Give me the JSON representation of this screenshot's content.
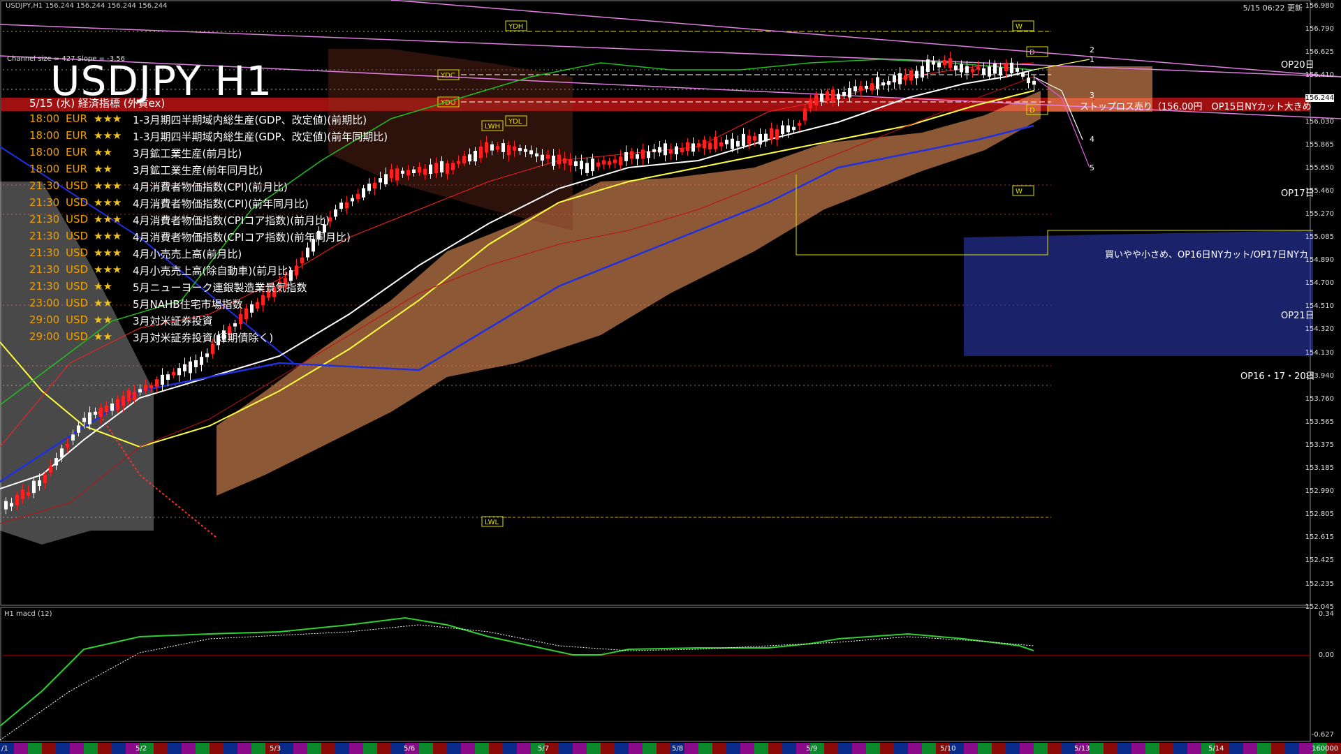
{
  "header": {
    "symbol_line": "USDJPY,H1  156.244 156.244 156.244 156.244",
    "title": "USDJPY H1",
    "channel_info": "Channel size = 427  Slope = -3.56",
    "timestamp": "5/15 06:22 更新"
  },
  "calendar": {
    "heading": "5/15 (水) 経済指標 (外貨ex)",
    "rows": [
      {
        "time": "18:00",
        "cur": "EUR",
        "stars": "★★★",
        "event": "1-3月期四半期域内総生産(GDP、改定値)(前期比)"
      },
      {
        "time": "18:00",
        "cur": "EUR",
        "stars": "★★★",
        "event": "1-3月期四半期域内総生産(GDP、改定値)(前年同期比)"
      },
      {
        "time": "18:00",
        "cur": "EUR",
        "stars": "★★",
        "event": "3月鉱工業生産(前月比)"
      },
      {
        "time": "18:00",
        "cur": "EUR",
        "stars": "★★",
        "event": "3月鉱工業生産(前年同月比)"
      },
      {
        "time": "21:30",
        "cur": "USD",
        "stars": "★★★",
        "event": "4月消費者物価指数(CPI)(前月比)"
      },
      {
        "time": "21:30",
        "cur": "USD",
        "stars": "★★★",
        "event": "4月消費者物価指数(CPI)(前年同月比)"
      },
      {
        "time": "21:30",
        "cur": "USD",
        "stars": "★★★",
        "event": "4月消費者物価指数(CPIコア指数)(前月比)"
      },
      {
        "time": "21:30",
        "cur": "USD",
        "stars": "★★★",
        "event": "4月消費者物価指数(CPIコア指数)(前年同月比)"
      },
      {
        "time": "21:30",
        "cur": "USD",
        "stars": "★★★",
        "event": "4月小売売上高(前月比)"
      },
      {
        "time": "21:30",
        "cur": "USD",
        "stars": "★★★",
        "event": "4月小売売上高(除自動車)(前月比)"
      },
      {
        "time": "21:30",
        "cur": "USD",
        "stars": "★★",
        "event": "5月ニューヨーク連銀製造業景気指数"
      },
      {
        "time": "23:00",
        "cur": "USD",
        "stars": "★★",
        "event": "5月NAHB住宅市場指数"
      },
      {
        "time": "29:00",
        "cur": "USD",
        "stars": "★★",
        "event": "3月対米証券投資"
      },
      {
        "time": "29:00",
        "cur": "USD",
        "stars": "★★",
        "event": "3月対米証券投資(短期債除く)"
      }
    ]
  },
  "level_tags": {
    "ydh": "YDH",
    "ydc": "YDC",
    "ydo": "YDO",
    "ydl": "YDL",
    "lwh": "LWH",
    "lwl": "LWL",
    "wh": "W",
    "wl": "W",
    "dh": "D",
    "dl": "D"
  },
  "wave_labels": [
    "2",
    "1",
    "3",
    "4",
    "5"
  ],
  "notes": {
    "stoploss": "ストップロス売り（156.00円　OP15日NYカット大きめ",
    "buy": "買いやや小さめ、OP16日NYカット/OP17日NYカ",
    "op20": "OP20日",
    "op17": "OP17日",
    "op21": "OP21日",
    "op16": "OP16・17・20日"
  },
  "price_axis": {
    "labels": [
      "156.980",
      "156.790",
      "156.625",
      "156.410",
      "156.244",
      "156.030",
      "155.865",
      "155.650",
      "155.460",
      "155.270",
      "155.085",
      "154.890",
      "154.700",
      "154.510",
      "154.320",
      "154.130",
      "153.940",
      "153.760",
      "153.565",
      "153.375",
      "153.185",
      "152.990",
      "152.805",
      "152.615",
      "152.425",
      "152.235",
      "152.045"
    ],
    "current": "156.244"
  },
  "macd": {
    "label": "H1  macd (12)",
    "axis": [
      "0.34",
      "0.00",
      "-0.627"
    ]
  },
  "date_axis": {
    "labels": [
      "/1",
      "5/2",
      "5/3",
      "5/6",
      "5/7",
      "5/8",
      "5/9",
      "5/10",
      "5/13",
      "5/14"
    ],
    "end_label": "160000"
  },
  "colors": {
    "background": "#000000",
    "bull_candle": "#ffffff",
    "bear_candle": "#ff2020",
    "sma_white": "#ffffff",
    "sma_yellow": "#ffff40",
    "sma_blue": "#2030e0",
    "channel_pink": "#e080e0",
    "cloud_orange": "#ffa060",
    "cloud_blue": "#3040c0",
    "macd_green": "#30d030",
    "macd_signal": "#ffffff",
    "stoploss_band": "#b01010",
    "level_yellow": "#e0e000"
  }
}
